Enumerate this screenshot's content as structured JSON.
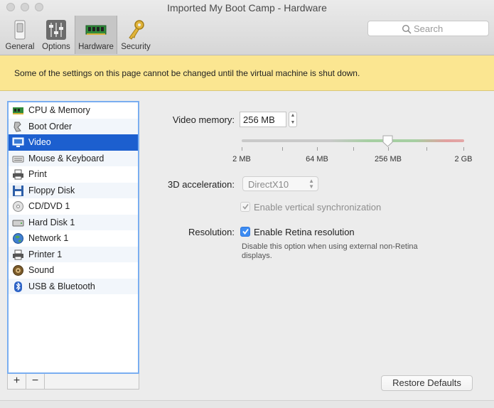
{
  "window": {
    "title": "Imported My Boot Camp - Hardware"
  },
  "toolbar": {
    "tabs": [
      {
        "label": "General",
        "icon": "switch-icon"
      },
      {
        "label": "Options",
        "icon": "sliders-icon"
      },
      {
        "label": "Hardware",
        "icon": "memory-chip-icon",
        "selected": true
      },
      {
        "label": "Security",
        "icon": "key-icon"
      }
    ],
    "search_placeholder": "Search"
  },
  "banner": {
    "text": "Some of the settings on this page cannot be changed until the virtual machine is shut down."
  },
  "device_list": {
    "items": [
      {
        "label": "CPU & Memory",
        "icon": "cpu-icon"
      },
      {
        "label": "Boot Order",
        "icon": "boot-order-icon"
      },
      {
        "label": "Video",
        "icon": "monitor-icon",
        "selected": true
      },
      {
        "label": "Mouse & Keyboard",
        "icon": "keyboard-icon"
      },
      {
        "label": "Print",
        "icon": "printer-icon"
      },
      {
        "label": "Floppy Disk",
        "icon": "floppy-icon"
      },
      {
        "label": "CD/DVD 1",
        "icon": "disc-icon"
      },
      {
        "label": "Hard Disk 1",
        "icon": "hard-disk-icon"
      },
      {
        "label": "Network 1",
        "icon": "globe-icon"
      },
      {
        "label": "Printer 1",
        "icon": "printer-icon"
      },
      {
        "label": "Sound",
        "icon": "speaker-icon"
      },
      {
        "label": "USB & Bluetooth",
        "icon": "bluetooth-icon"
      }
    ],
    "add_label": "+",
    "remove_label": "−"
  },
  "video": {
    "memory_label": "Video memory:",
    "memory_value": "256 MB",
    "slider": {
      "ticks": [
        "2 MB",
        "64 MB",
        "256 MB",
        "2 GB"
      ],
      "selected": "256 MB"
    },
    "acceleration_label": "3D acceleration:",
    "acceleration_value": "DirectX10",
    "vsync_label": "Enable vertical synchronization",
    "vsync_checked": true,
    "resolution_label": "Resolution:",
    "retina_label": "Enable Retina resolution",
    "retina_checked": true,
    "retina_hint": "Disable this option when using external non-Retina displays."
  },
  "footer": {
    "restore_label": "Restore Defaults"
  },
  "colors": {
    "selection": "#1c5fcf",
    "banner": "#fbe691",
    "checkbox_accent": "#3d8cf2"
  }
}
